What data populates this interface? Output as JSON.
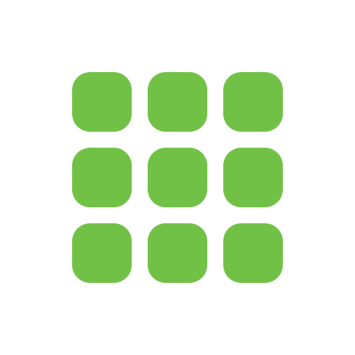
{
  "app_icon": {
    "icon_name": "app-grid-icon",
    "accent_color": "#72c147",
    "background_color": "#ffffff",
    "rows": 3,
    "columns": 3
  }
}
